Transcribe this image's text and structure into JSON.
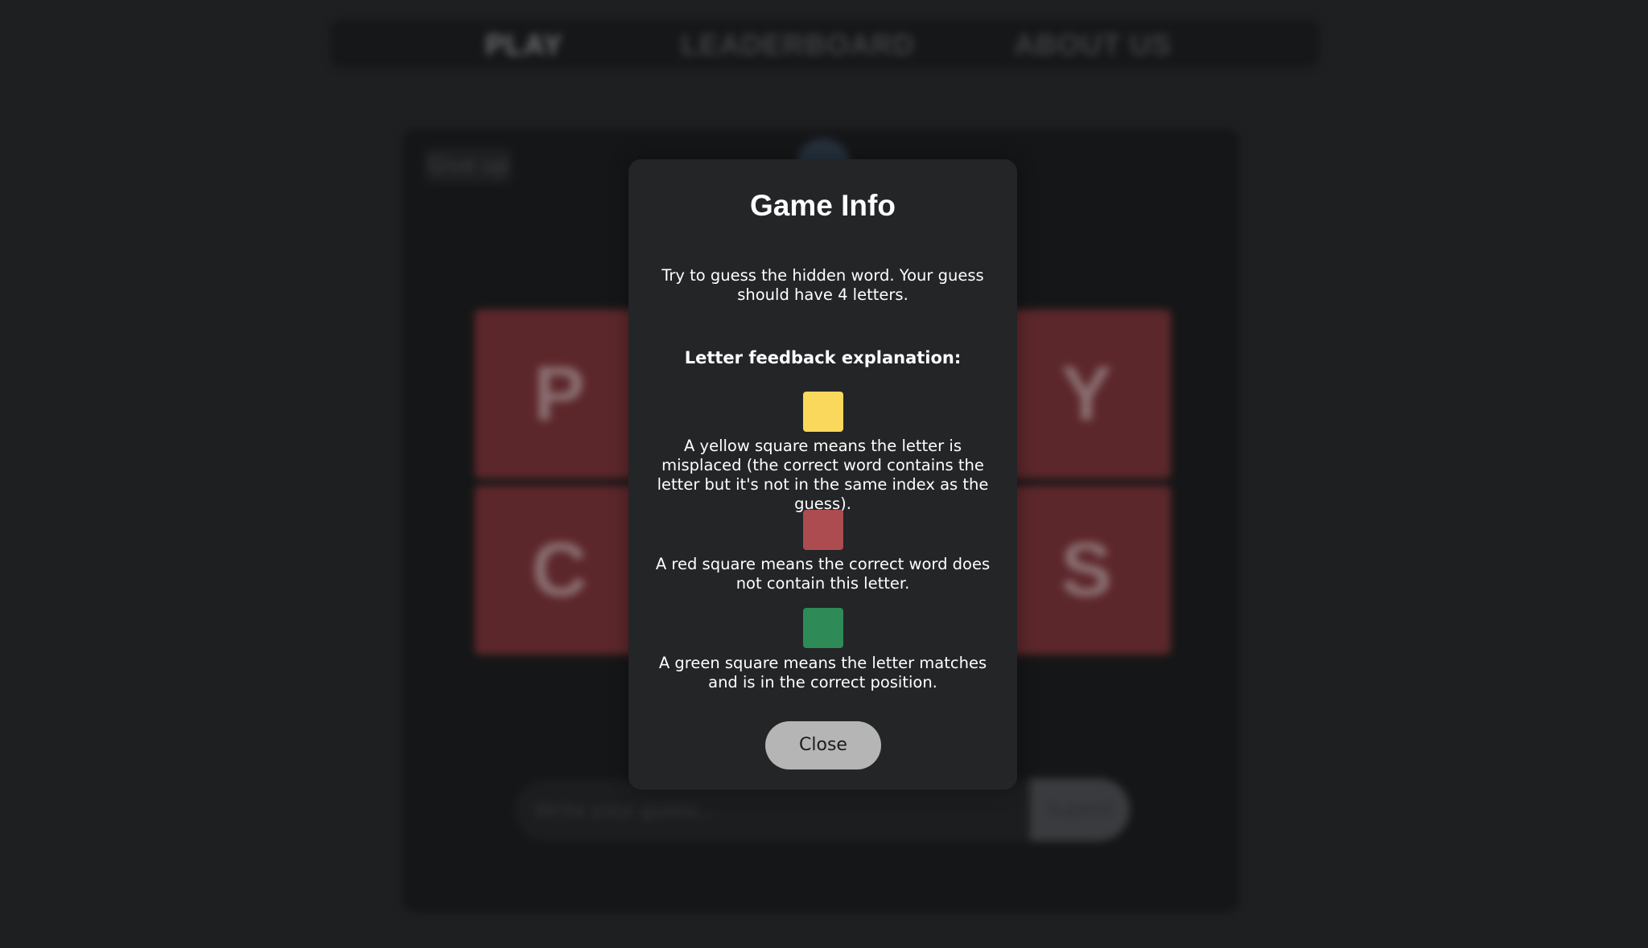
{
  "nav": {
    "items": [
      "PLAY",
      "LEADERBOARD",
      "ABOUT US"
    ]
  },
  "game": {
    "give_up_label": "Give up",
    "tiles": [
      "P",
      "Y",
      "C",
      "S"
    ],
    "input_placeholder": "Write your guess...",
    "submit_label": "Submit"
  },
  "modal": {
    "title": "Game Info",
    "intro": "Try to guess the hidden word. Your guess should have 4 letters.",
    "feedback_title": "Letter feedback explanation:",
    "legend": [
      {
        "color": "#f9d85b",
        "text": "A yellow square means the letter is misplaced (the correct word contains the letter but it's not in the same index as the guess)."
      },
      {
        "color": "#ac4b50",
        "text": "A red square means the correct word does not contain this letter."
      },
      {
        "color": "#2e8b57",
        "text": "A green square means the letter matches and is in the correct position."
      }
    ],
    "close_label": "Close"
  }
}
